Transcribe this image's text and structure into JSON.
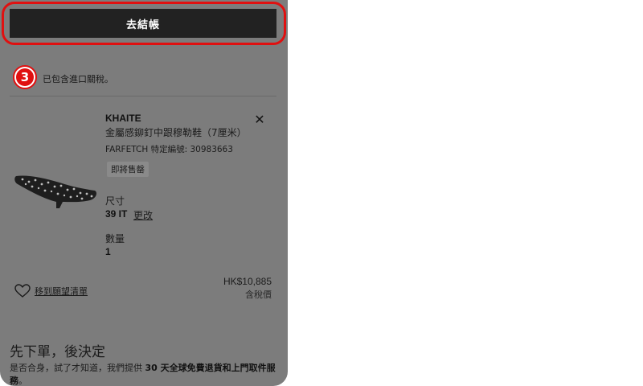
{
  "checkout": {
    "label": "去結帳"
  },
  "step_badge": {
    "number": "3"
  },
  "tax_note": "已包含進口關稅。",
  "product": {
    "brand": "KHAITE",
    "name": "金屬感鉚釘中跟穆勒鞋（7厘米）",
    "sku": "FARFETCH 特定編號: 30983663",
    "tag": "即將售罄",
    "size_label": "尺寸",
    "size_value": "39 IT",
    "size_change": "更改",
    "qty_label": "數量",
    "qty_value": "1",
    "price": "HK$10,885",
    "price_note": "含稅價",
    "wishlist": "移到願望清單"
  },
  "icons": {
    "close": "close-icon",
    "heart": "heart-icon"
  },
  "info_section": {
    "title": "先下單，後決定",
    "body_prefix": "是否合身，試了才知道，我們提供 ",
    "body_bold": "30 天全球免費退貨和上門取件服務",
    "body_suffix": "。"
  },
  "colors": {
    "overlay": "#7c7c7c",
    "button": "#222222",
    "highlight": "#e01010"
  }
}
